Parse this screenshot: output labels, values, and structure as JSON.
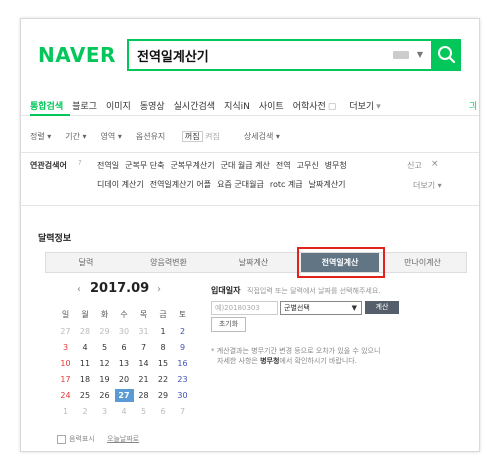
{
  "search": {
    "logo": "NAVER",
    "query": "전역일계산기",
    "colors": {
      "brand": "#03c75a",
      "active_tab": "#627585",
      "highlight": "#e2231a",
      "today": "#5b9bd5"
    }
  },
  "nav": {
    "tabs": [
      "통합검색",
      "블로그",
      "이미지",
      "동영상",
      "실시간검색",
      "지식iN",
      "사이트",
      "어학사전",
      "더보기"
    ],
    "dictionary_suffix": "▢",
    "more_arrow": "▾",
    "overflow": "긔"
  },
  "options": {
    "items": [
      "정렬 ▾",
      "기간 ▾",
      "영역 ▾",
      "옵션유지",
      "상세검색 ▾"
    ],
    "toggle_on": "꺼짐",
    "toggle_off": "켜짐"
  },
  "related": {
    "title": "연관검색어",
    "help": "?",
    "row1": [
      "전역일",
      "군복무 단축",
      "군복무계산기",
      "군대 월급 계산",
      "전역",
      "고무신",
      "병무청"
    ],
    "row2": [
      "디데이 계산기",
      "전역일계산기 어플",
      "요즘 군대월급",
      "rotc 계급",
      "날짜계산기"
    ],
    "report": "신고",
    "close": "×",
    "more": "더보기 ▾"
  },
  "section": {
    "title": "달력정보",
    "tabs": [
      "달력",
      "양음력변환",
      "날짜계산",
      "전역일계산",
      "만나이계산"
    ],
    "selected_tab": "전역일계산"
  },
  "calendar": {
    "month": "2017.09",
    "prev": "‹",
    "next": "›",
    "weekdays": [
      "일",
      "월",
      "화",
      "수",
      "목",
      "금",
      "토"
    ],
    "weeks": [
      [
        "27",
        "28",
        "29",
        "30",
        "31",
        "1",
        "2"
      ],
      [
        "3",
        "4",
        "5",
        "6",
        "7",
        "8",
        "9"
      ],
      [
        "10",
        "11",
        "12",
        "13",
        "14",
        "15",
        "16"
      ],
      [
        "17",
        "18",
        "19",
        "20",
        "21",
        "22",
        "23"
      ],
      [
        "24",
        "25",
        "26",
        "27",
        "28",
        "29",
        "30"
      ],
      [
        "1",
        "2",
        "3",
        "4",
        "5",
        "6",
        "7"
      ]
    ],
    "today": "27",
    "footer_lunar": "음력표시",
    "footer_today": "오늘날짜로"
  },
  "calc": {
    "label": "입대일자",
    "hint": "직접입력 또는 달력에서 날짜를 선택해주세요.",
    "date_placeholder": "예)20180303",
    "branch_select": "군별선택",
    "calc_button": "계산",
    "reset_button": "초기화",
    "note_line1": "* 계산결과는 병무기간 변경 등으로 오차가 있을 수 있으니",
    "note_line2_pre": "자세한 사항은 ",
    "note_line2_link": "병무청",
    "note_line2_post": "에서 확인하시기 바랍니다."
  }
}
